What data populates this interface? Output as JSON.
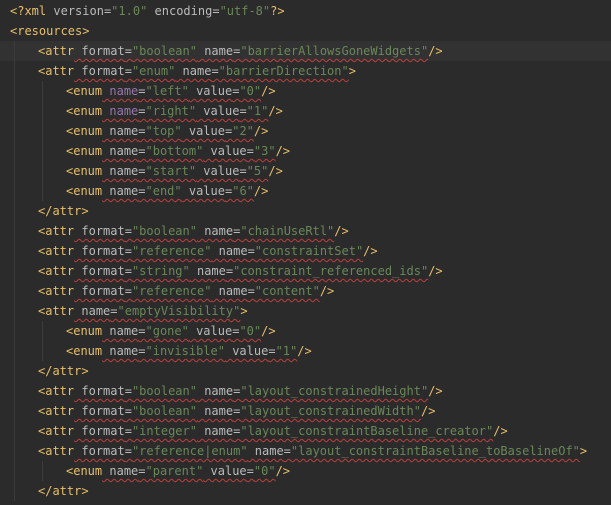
{
  "editor": {
    "lines": [
      {
        "indent": 0,
        "tokens": [
          {
            "t": "<?",
            "c": "tag"
          },
          {
            "t": "xml",
            "c": "tag"
          },
          {
            "t": " version",
            "c": "attr"
          },
          {
            "t": "=",
            "c": "eq"
          },
          {
            "t": "\"1.0\"",
            "c": "str"
          },
          {
            "t": " encoding",
            "c": "attr"
          },
          {
            "t": "=",
            "c": "eq"
          },
          {
            "t": "\"utf-8\"",
            "c": "str"
          },
          {
            "t": "?>",
            "c": "tag"
          }
        ]
      },
      {
        "indent": 0,
        "tokens": [
          {
            "t": "<",
            "c": "tag"
          },
          {
            "t": "resources",
            "c": "tag"
          },
          {
            "t": ">",
            "c": "tag"
          }
        ]
      },
      {
        "indent": 1,
        "current": true,
        "tokens": [
          {
            "t": "<",
            "c": "tag"
          },
          {
            "t": "attr",
            "c": "tag"
          },
          {
            "t": " format",
            "c": "attr",
            "sq": true
          },
          {
            "t": "=",
            "c": "eq",
            "sq": true
          },
          {
            "t": "\"boolean\"",
            "c": "str",
            "sq": true
          },
          {
            "t": " name",
            "c": "attr",
            "sq": true
          },
          {
            "t": "=",
            "c": "eq",
            "sq": true
          },
          {
            "t": "\"barrierAllowsGoneWidgets\"",
            "c": "str",
            "sq": true
          },
          {
            "t": "/>",
            "c": "tag"
          }
        ]
      },
      {
        "indent": 1,
        "tokens": [
          {
            "t": "<",
            "c": "tag"
          },
          {
            "t": "attr",
            "c": "tag"
          },
          {
            "t": " format",
            "c": "attr",
            "sq": true
          },
          {
            "t": "=",
            "c": "eq",
            "sq": true
          },
          {
            "t": "\"enum\"",
            "c": "str",
            "sq": true
          },
          {
            "t": " name",
            "c": "attr",
            "sq": true
          },
          {
            "t": "=",
            "c": "eq",
            "sq": true
          },
          {
            "t": "\"barrierDirection\"",
            "c": "str",
            "sq": true
          },
          {
            "t": ">",
            "c": "tag"
          }
        ]
      },
      {
        "indent": 2,
        "tokens": [
          {
            "t": "<",
            "c": "tag"
          },
          {
            "t": "enum",
            "c": "tag"
          },
          {
            "t": " name",
            "c": "attr-name",
            "sq": true
          },
          {
            "t": "=",
            "c": "eq",
            "sq": true
          },
          {
            "t": "\"left\"",
            "c": "str",
            "sq": true
          },
          {
            "t": " value",
            "c": "attr",
            "sq": true
          },
          {
            "t": "=",
            "c": "eq",
            "sq": true
          },
          {
            "t": "\"0\"",
            "c": "str",
            "sq": true
          },
          {
            "t": "/>",
            "c": "tag"
          }
        ]
      },
      {
        "indent": 2,
        "tokens": [
          {
            "t": "<",
            "c": "tag"
          },
          {
            "t": "enum",
            "c": "tag"
          },
          {
            "t": " name",
            "c": "attr-name",
            "sq": true
          },
          {
            "t": "=",
            "c": "eq",
            "sq": true
          },
          {
            "t": "\"right\"",
            "c": "str",
            "sq": true
          },
          {
            "t": " value",
            "c": "attr",
            "sq": true
          },
          {
            "t": "=",
            "c": "eq",
            "sq": true
          },
          {
            "t": "\"1\"",
            "c": "str",
            "sq": true
          },
          {
            "t": "/>",
            "c": "tag"
          }
        ]
      },
      {
        "indent": 2,
        "tokens": [
          {
            "t": "<",
            "c": "tag"
          },
          {
            "t": "enum",
            "c": "tag"
          },
          {
            "t": " name",
            "c": "attr",
            "sq": true
          },
          {
            "t": "=",
            "c": "eq",
            "sq": true
          },
          {
            "t": "\"top\"",
            "c": "str",
            "sq": true
          },
          {
            "t": " value",
            "c": "attr",
            "sq": true
          },
          {
            "t": "=",
            "c": "eq",
            "sq": true
          },
          {
            "t": "\"2\"",
            "c": "str",
            "sq": true
          },
          {
            "t": "/>",
            "c": "tag"
          }
        ]
      },
      {
        "indent": 2,
        "tokens": [
          {
            "t": "<",
            "c": "tag"
          },
          {
            "t": "enum",
            "c": "tag"
          },
          {
            "t": " name",
            "c": "attr",
            "sq": true
          },
          {
            "t": "=",
            "c": "eq",
            "sq": true
          },
          {
            "t": "\"bottom\"",
            "c": "str",
            "sq": true
          },
          {
            "t": " value",
            "c": "attr",
            "sq": true
          },
          {
            "t": "=",
            "c": "eq",
            "sq": true
          },
          {
            "t": "\"3\"",
            "c": "str",
            "sq": true
          },
          {
            "t": "/>",
            "c": "tag"
          }
        ]
      },
      {
        "indent": 2,
        "tokens": [
          {
            "t": "<",
            "c": "tag"
          },
          {
            "t": "enum",
            "c": "tag"
          },
          {
            "t": " name",
            "c": "attr",
            "sq": true
          },
          {
            "t": "=",
            "c": "eq",
            "sq": true
          },
          {
            "t": "\"start\"",
            "c": "str",
            "sq": true
          },
          {
            "t": " value",
            "c": "attr",
            "sq": true
          },
          {
            "t": "=",
            "c": "eq",
            "sq": true
          },
          {
            "t": "\"5\"",
            "c": "str",
            "sq": true
          },
          {
            "t": "/>",
            "c": "tag"
          }
        ]
      },
      {
        "indent": 2,
        "tokens": [
          {
            "t": "<",
            "c": "tag"
          },
          {
            "t": "enum",
            "c": "tag"
          },
          {
            "t": " name",
            "c": "attr",
            "sq": true
          },
          {
            "t": "=",
            "c": "eq",
            "sq": true
          },
          {
            "t": "\"end\"",
            "c": "str",
            "sq": true
          },
          {
            "t": " value",
            "c": "attr",
            "sq": true
          },
          {
            "t": "=",
            "c": "eq",
            "sq": true
          },
          {
            "t": "\"6\"",
            "c": "str",
            "sq": true
          },
          {
            "t": "/>",
            "c": "tag"
          }
        ]
      },
      {
        "indent": 1,
        "tokens": [
          {
            "t": "</",
            "c": "tag"
          },
          {
            "t": "attr",
            "c": "tag"
          },
          {
            "t": ">",
            "c": "tag"
          }
        ]
      },
      {
        "indent": 1,
        "tokens": [
          {
            "t": "<",
            "c": "tag"
          },
          {
            "t": "attr",
            "c": "tag"
          },
          {
            "t": " format",
            "c": "attr",
            "sq": true
          },
          {
            "t": "=",
            "c": "eq",
            "sq": true
          },
          {
            "t": "\"boolean\"",
            "c": "str",
            "sq": true
          },
          {
            "t": " name",
            "c": "attr",
            "sq": true
          },
          {
            "t": "=",
            "c": "eq",
            "sq": true
          },
          {
            "t": "\"chainUseRtl\"",
            "c": "str",
            "sq": true
          },
          {
            "t": "/>",
            "c": "tag"
          }
        ]
      },
      {
        "indent": 1,
        "tokens": [
          {
            "t": "<",
            "c": "tag"
          },
          {
            "t": "attr",
            "c": "tag"
          },
          {
            "t": " format",
            "c": "attr",
            "sq": true
          },
          {
            "t": "=",
            "c": "eq",
            "sq": true
          },
          {
            "t": "\"reference\"",
            "c": "str",
            "sq": true
          },
          {
            "t": " name",
            "c": "attr",
            "sq": true
          },
          {
            "t": "=",
            "c": "eq",
            "sq": true
          },
          {
            "t": "\"constraintSet\"",
            "c": "str",
            "sq": true
          },
          {
            "t": "/>",
            "c": "tag"
          }
        ]
      },
      {
        "indent": 1,
        "tokens": [
          {
            "t": "<",
            "c": "tag"
          },
          {
            "t": "attr",
            "c": "tag"
          },
          {
            "t": " format",
            "c": "attr",
            "sq": true
          },
          {
            "t": "=",
            "c": "eq",
            "sq": true
          },
          {
            "t": "\"string\"",
            "c": "str",
            "sq": true
          },
          {
            "t": " name",
            "c": "attr",
            "sq": true
          },
          {
            "t": "=",
            "c": "eq",
            "sq": true
          },
          {
            "t": "\"constraint_referenced_ids\"",
            "c": "str",
            "sq": true
          },
          {
            "t": "/>",
            "c": "tag"
          }
        ]
      },
      {
        "indent": 1,
        "tokens": [
          {
            "t": "<",
            "c": "tag"
          },
          {
            "t": "attr",
            "c": "tag"
          },
          {
            "t": " format",
            "c": "attr",
            "sq": true
          },
          {
            "t": "=",
            "c": "eq",
            "sq": true
          },
          {
            "t": "\"reference\"",
            "c": "str",
            "sq": true
          },
          {
            "t": " name",
            "c": "attr",
            "sq": true
          },
          {
            "t": "=",
            "c": "eq",
            "sq": true
          },
          {
            "t": "\"content\"",
            "c": "str",
            "sq": true
          },
          {
            "t": "/>",
            "c": "tag"
          }
        ]
      },
      {
        "indent": 1,
        "tokens": [
          {
            "t": "<",
            "c": "tag"
          },
          {
            "t": "attr",
            "c": "tag"
          },
          {
            "t": " name",
            "c": "attr",
            "sq": true
          },
          {
            "t": "=",
            "c": "eq",
            "sq": true
          },
          {
            "t": "\"emptyVisibility\"",
            "c": "str",
            "sq": true
          },
          {
            "t": ">",
            "c": "tag"
          }
        ]
      },
      {
        "indent": 2,
        "tokens": [
          {
            "t": "<",
            "c": "tag"
          },
          {
            "t": "enum",
            "c": "tag"
          },
          {
            "t": " name",
            "c": "attr",
            "sq": true
          },
          {
            "t": "=",
            "c": "eq",
            "sq": true
          },
          {
            "t": "\"gone\"",
            "c": "str",
            "sq": true
          },
          {
            "t": " value",
            "c": "attr",
            "sq": true
          },
          {
            "t": "=",
            "c": "eq",
            "sq": true
          },
          {
            "t": "\"0\"",
            "c": "str",
            "sq": true
          },
          {
            "t": "/>",
            "c": "tag"
          }
        ]
      },
      {
        "indent": 2,
        "tokens": [
          {
            "t": "<",
            "c": "tag"
          },
          {
            "t": "enum",
            "c": "tag"
          },
          {
            "t": " name",
            "c": "attr",
            "sq": true
          },
          {
            "t": "=",
            "c": "eq",
            "sq": true
          },
          {
            "t": "\"invisible\"",
            "c": "str",
            "sq": true
          },
          {
            "t": " value",
            "c": "attr",
            "sq": true
          },
          {
            "t": "=",
            "c": "eq",
            "sq": true
          },
          {
            "t": "\"1\"",
            "c": "str",
            "sq": true
          },
          {
            "t": "/>",
            "c": "tag"
          }
        ]
      },
      {
        "indent": 1,
        "tokens": [
          {
            "t": "</",
            "c": "tag"
          },
          {
            "t": "attr",
            "c": "tag"
          },
          {
            "t": ">",
            "c": "tag"
          }
        ]
      },
      {
        "indent": 1,
        "tokens": [
          {
            "t": "<",
            "c": "tag"
          },
          {
            "t": "attr",
            "c": "tag"
          },
          {
            "t": " format",
            "c": "attr",
            "sq": true
          },
          {
            "t": "=",
            "c": "eq",
            "sq": true
          },
          {
            "t": "\"boolean\"",
            "c": "str",
            "sq": true
          },
          {
            "t": " name",
            "c": "attr",
            "sq": true
          },
          {
            "t": "=",
            "c": "eq",
            "sq": true
          },
          {
            "t": "\"layout_constrainedHeight\"",
            "c": "str",
            "sq": true
          },
          {
            "t": "/>",
            "c": "tag"
          }
        ]
      },
      {
        "indent": 1,
        "tokens": [
          {
            "t": "<",
            "c": "tag"
          },
          {
            "t": "attr",
            "c": "tag"
          },
          {
            "t": " format",
            "c": "attr",
            "sq": true
          },
          {
            "t": "=",
            "c": "eq",
            "sq": true
          },
          {
            "t": "\"boolean\"",
            "c": "str",
            "sq": true
          },
          {
            "t": " name",
            "c": "attr",
            "sq": true
          },
          {
            "t": "=",
            "c": "eq",
            "sq": true
          },
          {
            "t": "\"layout_constrainedWidth\"",
            "c": "str",
            "sq": true
          },
          {
            "t": "/>",
            "c": "tag"
          }
        ]
      },
      {
        "indent": 1,
        "tokens": [
          {
            "t": "<",
            "c": "tag"
          },
          {
            "t": "attr",
            "c": "tag"
          },
          {
            "t": " format",
            "c": "attr",
            "sq": true
          },
          {
            "t": "=",
            "c": "eq",
            "sq": true
          },
          {
            "t": "\"integer\"",
            "c": "str",
            "sq": true
          },
          {
            "t": " name",
            "c": "attr",
            "sq": true
          },
          {
            "t": "=",
            "c": "eq",
            "sq": true
          },
          {
            "t": "\"layout_constraintBaseline_creator\"",
            "c": "str",
            "sq": true
          },
          {
            "t": "/>",
            "c": "tag"
          }
        ]
      },
      {
        "indent": 1,
        "tokens": [
          {
            "t": "<",
            "c": "tag"
          },
          {
            "t": "attr",
            "c": "tag"
          },
          {
            "t": " format",
            "c": "attr",
            "sq": true
          },
          {
            "t": "=",
            "c": "eq",
            "sq": true
          },
          {
            "t": "\"reference|enum\"",
            "c": "str",
            "sq": true
          },
          {
            "t": " name",
            "c": "attr",
            "sq": true
          },
          {
            "t": "=",
            "c": "eq",
            "sq": true
          },
          {
            "t": "\"layout_constraintBaseline_toBaselineOf\"",
            "c": "str",
            "sq": true
          },
          {
            "t": ">",
            "c": "tag"
          }
        ]
      },
      {
        "indent": 2,
        "tokens": [
          {
            "t": "<",
            "c": "tag"
          },
          {
            "t": "enum",
            "c": "tag"
          },
          {
            "t": " name",
            "c": "attr",
            "sq": true
          },
          {
            "t": "=",
            "c": "eq",
            "sq": true
          },
          {
            "t": "\"parent\"",
            "c": "str",
            "sq": true
          },
          {
            "t": " value",
            "c": "attr",
            "sq": true
          },
          {
            "t": "=",
            "c": "eq",
            "sq": true
          },
          {
            "t": "\"0\"",
            "c": "str",
            "sq": true
          },
          {
            "t": "/>",
            "c": "tag"
          }
        ]
      },
      {
        "indent": 1,
        "tokens": [
          {
            "t": "</",
            "c": "tag"
          },
          {
            "t": "attr",
            "c": "tag"
          },
          {
            "t": ">",
            "c": "tag"
          }
        ]
      }
    ]
  },
  "colors": {
    "background": "#2b2b2b",
    "current_line": "#323232",
    "tag": "#e8bf6a",
    "attribute": "#bababa",
    "attribute_name_highlight": "#9876aa",
    "string": "#6a8759",
    "squiggle": "#bc3f3c"
  }
}
